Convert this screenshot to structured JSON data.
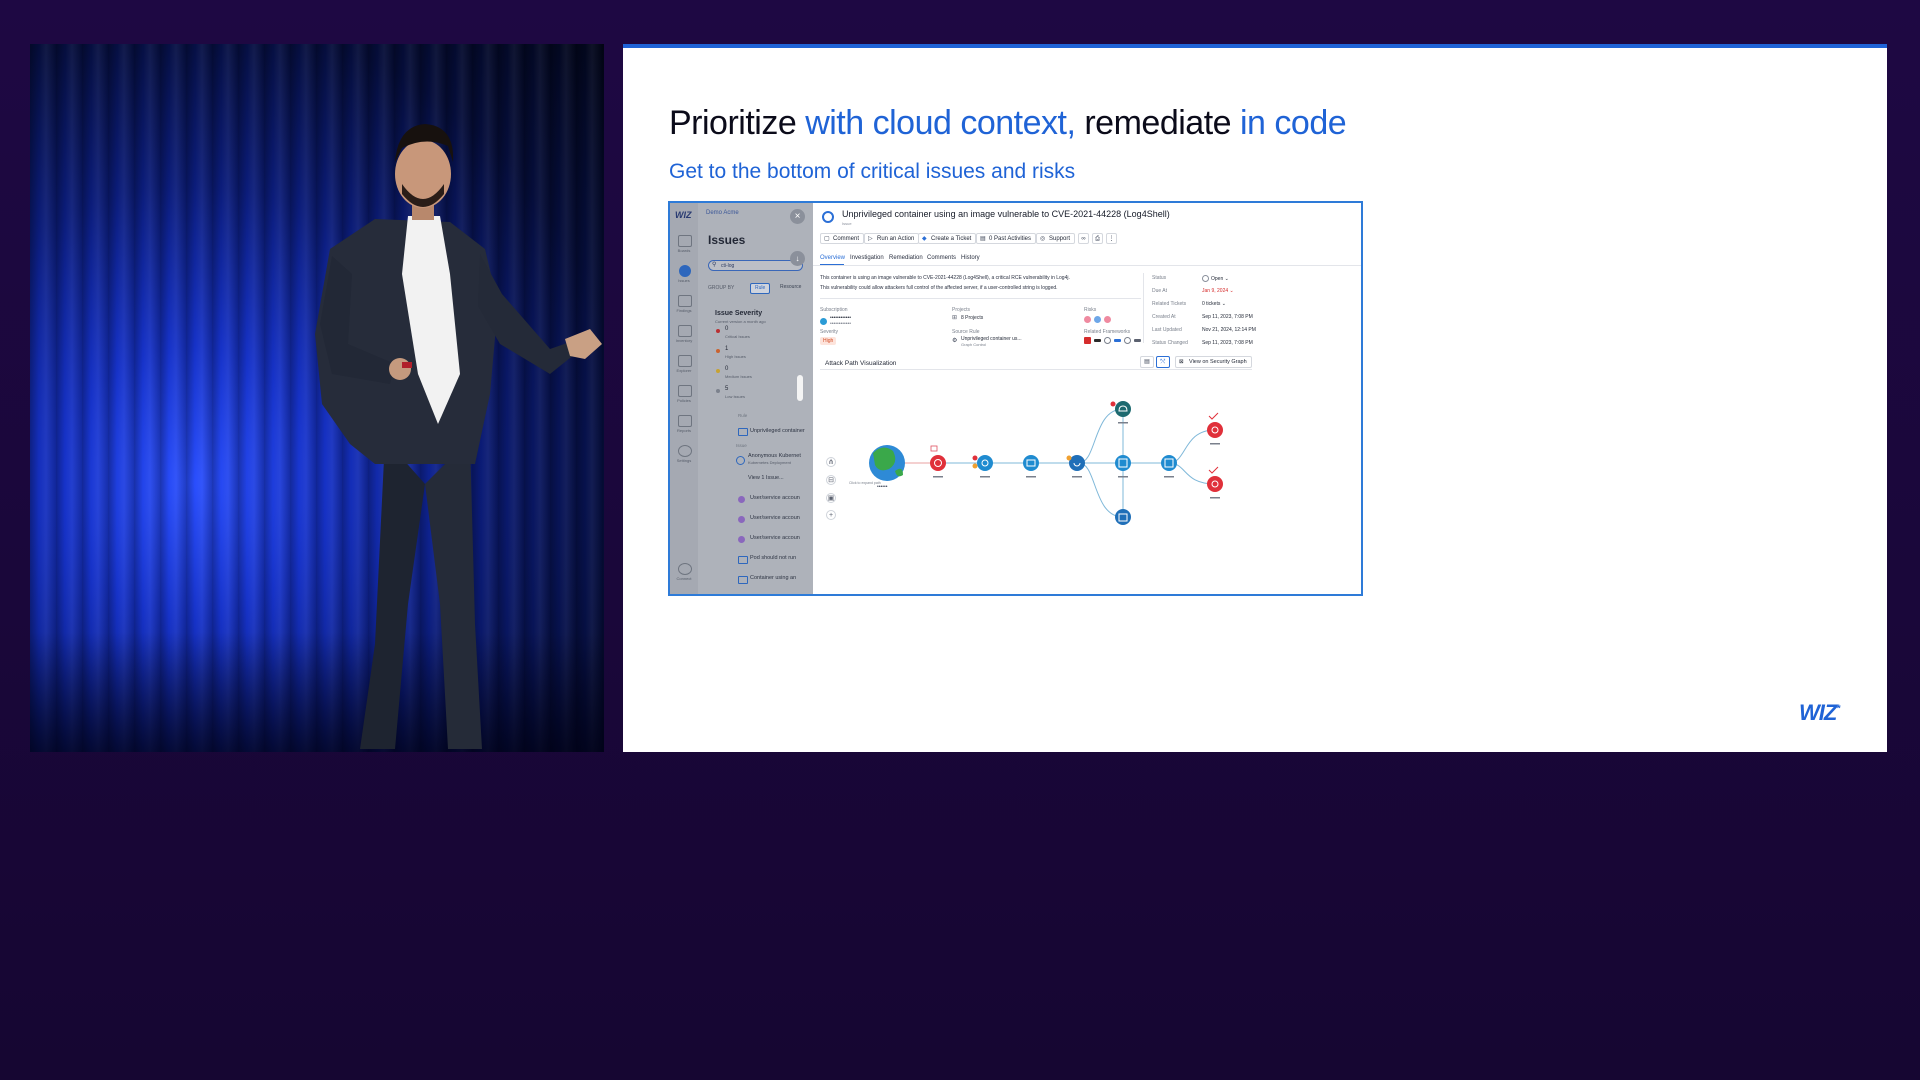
{
  "slide": {
    "title_part1": "Prioritize ",
    "title_part2": "with cloud context,",
    "title_part3": " remediate ",
    "title_part4": "in code",
    "subtitle": "Get to the bottom of critical issues and risks",
    "logo": "WIZ",
    "accent_color": "#1f63d6"
  },
  "left_panel": {
    "logo": "WIZ",
    "top_link": "Demo Acme",
    "title": "Issues",
    "search_value": "cti-log",
    "group_by_label": "GROUP BY",
    "group_options": [
      "Rule",
      "Resource"
    ],
    "severity_title": "Issue Severity",
    "severity_subtitle": "Current version a month ago",
    "rail_items": [
      "Boards",
      "Issues",
      "Findings",
      "Inventory",
      "Explorer",
      "Policies",
      "Reports",
      "Settings",
      "Connect"
    ],
    "severity_counts": [
      {
        "count": "0",
        "label": "Critical Issues",
        "color": "#d52c2c"
      },
      {
        "count": "1",
        "label": "High Issues",
        "color": "#e86a2a"
      },
      {
        "count": "0",
        "label": "Medium Issues",
        "color": "#e6b82e"
      },
      {
        "count": "5",
        "label": "Low Issues",
        "color": "#8a909c"
      }
    ],
    "rows": [
      {
        "text": "Rule"
      },
      {
        "text": "Unprivileged container"
      },
      {
        "text": "Issue"
      },
      {
        "text": "Anonymous Kubernet"
      },
      {
        "text": "Kubernetes Deployment"
      },
      {
        "text": "View 1 Issue..."
      },
      {
        "text": "User/service accoun"
      },
      {
        "text": "User/service accoun"
      },
      {
        "text": "User/service accoun"
      },
      {
        "text": "Pod should not run"
      },
      {
        "text": "Container using an"
      }
    ]
  },
  "issue": {
    "title": "Unprivileged container using an image vulnerable to CVE-2021-44228 (Log4Shell)",
    "kind": "Issue",
    "actions": [
      "Comment",
      "Run an Action",
      "Create a Ticket",
      "0 Past Activities",
      "Support"
    ],
    "tabs": [
      "Overview",
      "Investigation",
      "Remediation",
      "Comments",
      "History"
    ],
    "description_line1": "This container is using an image vulnerable to CVE-2021-44228 (Log4Shell), a critical RCE vulnerability in Log4j.",
    "description_line2": "This vulnerability could allow attackers full control of the affected server, if a user-controlled string is logged.",
    "subscription_label": "Subscription",
    "subscription_value": "••••••••••••",
    "subscription_value2": "••••••••••••",
    "projects_label": "Projects",
    "projects_value": "8 Projects",
    "risks_label": "Risks",
    "severity_label": "Severity",
    "severity_value": "High",
    "source_rule_label": "Source Rule",
    "source_rule_value": "Unprivileged container us...",
    "source_rule_sub": "Graph Control",
    "frameworks_label": "Related Frameworks",
    "status": [
      {
        "label": "Status",
        "value": "Open"
      },
      {
        "label": "Due At",
        "value": "Jan 9, 2024"
      },
      {
        "label": "Related Tickets",
        "value": "0 tickets"
      },
      {
        "label": "Created At",
        "value": "Sep 11, 2023, 7:08 PM"
      },
      {
        "label": "Last Updated",
        "value": "Nov 21, 2024, 12:14 PM"
      },
      {
        "label": "Status Changed",
        "value": "Sep 11, 2023, 7:08 PM"
      }
    ],
    "attack_path_title": "Attack Path Visualization",
    "view_graph_label": "View on Security Graph",
    "globe_label": "••••••",
    "expand_hint": "Click to expand path"
  }
}
